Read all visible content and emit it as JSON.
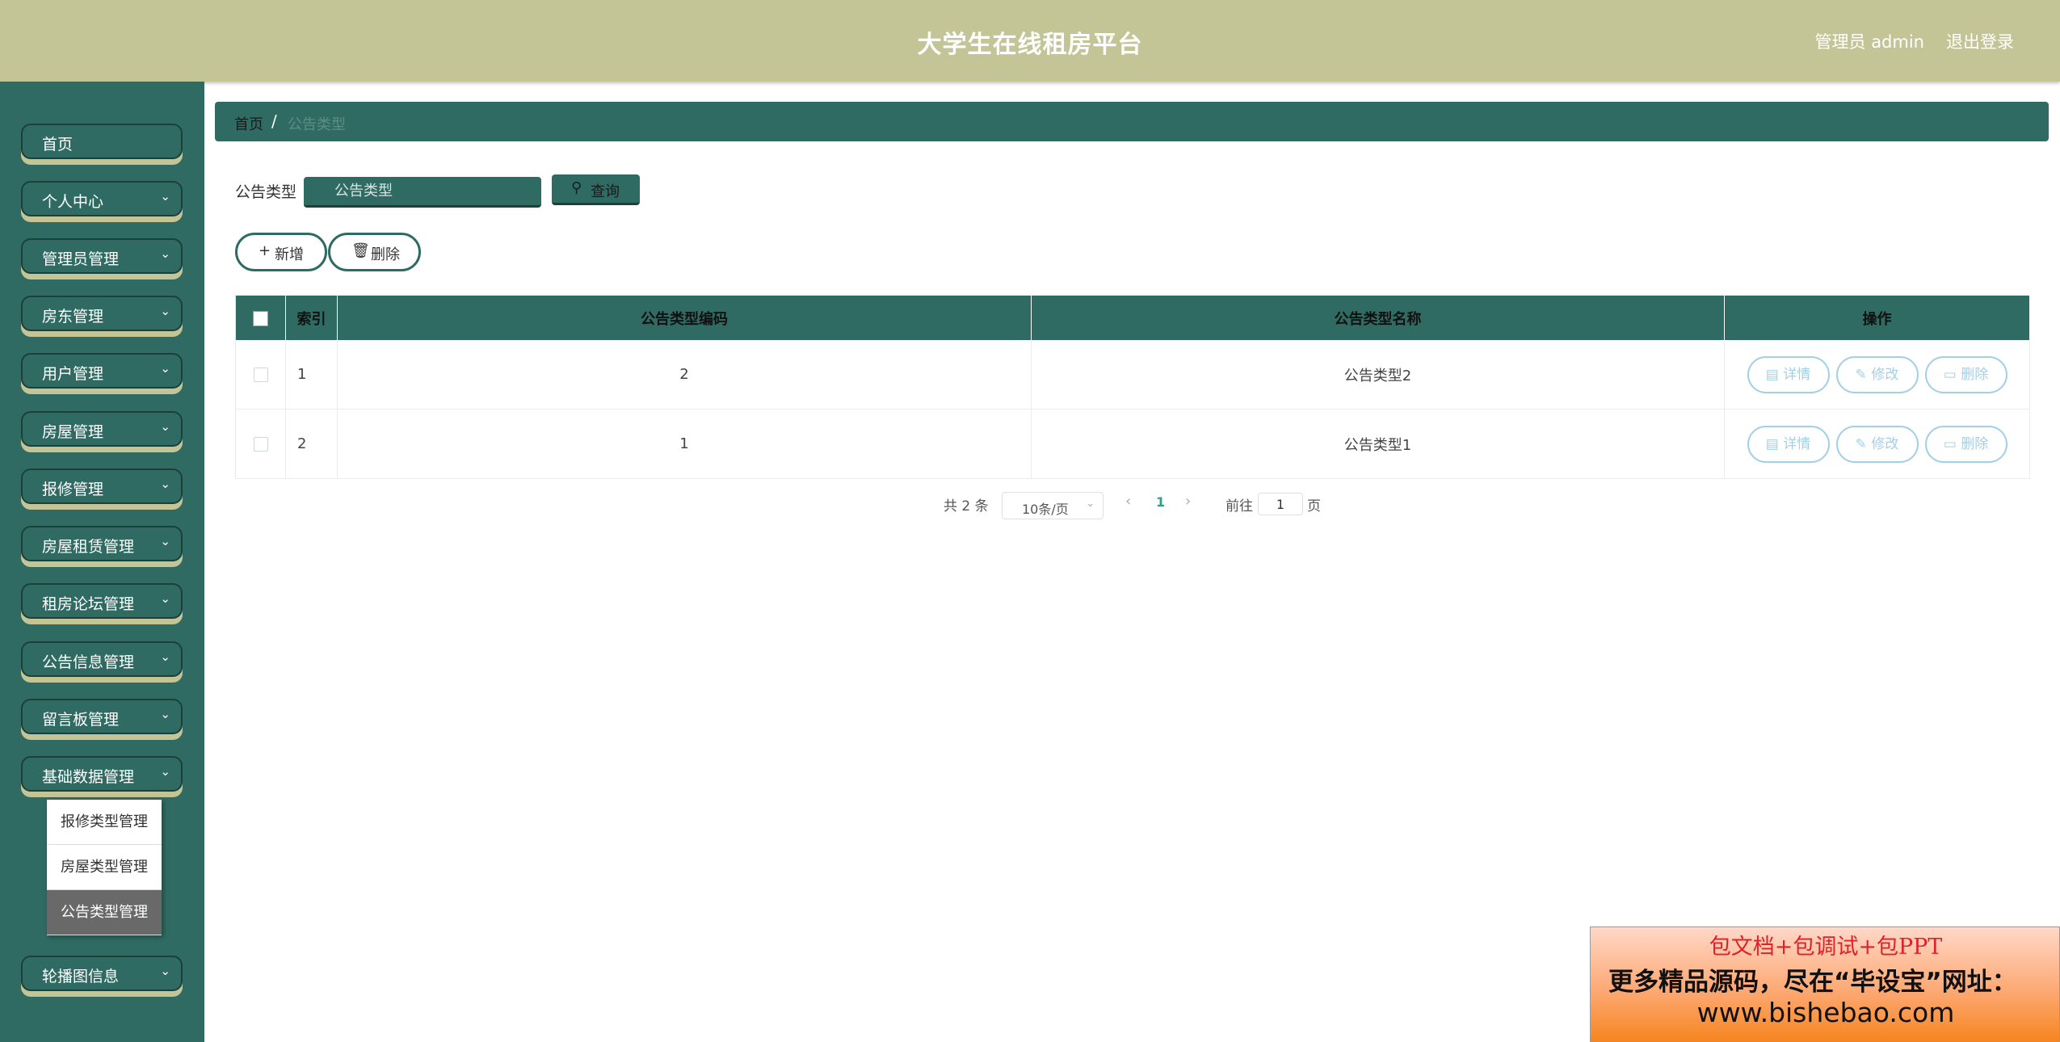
{
  "header": {
    "title": "大学生在线租房平台",
    "admin_label": "管理员 admin",
    "logout": "退出登录"
  },
  "sidebar": {
    "items": [
      {
        "label": "首页",
        "has_chevron": false
      },
      {
        "label": "个人中心",
        "has_chevron": true
      },
      {
        "label": "管理员管理",
        "has_chevron": true
      },
      {
        "label": "房东管理",
        "has_chevron": true
      },
      {
        "label": "用户管理",
        "has_chevron": true
      },
      {
        "label": "房屋管理",
        "has_chevron": true
      },
      {
        "label": "报修管理",
        "has_chevron": true
      },
      {
        "label": "房屋租赁管理",
        "has_chevron": true
      },
      {
        "label": "租房论坛管理",
        "has_chevron": true
      },
      {
        "label": "公告信息管理",
        "has_chevron": true
      },
      {
        "label": "留言板管理",
        "has_chevron": true
      },
      {
        "label": "基础数据管理",
        "has_chevron": true
      },
      {
        "label": "轮播图信息",
        "has_chevron": true
      }
    ],
    "submenu": [
      {
        "label": "报修类型管理",
        "active": false
      },
      {
        "label": "房屋类型管理",
        "active": false
      },
      {
        "label": "公告类型管理",
        "active": true
      }
    ]
  },
  "breadcrumb": {
    "home": "首页",
    "separator": "/",
    "current": "公告类型"
  },
  "search": {
    "label": "公告类型",
    "placeholder": "公告类型",
    "button": "查询",
    "button_icon": "search-icon"
  },
  "actions": {
    "add": "新增",
    "add_icon": "plus-icon",
    "delete": "删除",
    "delete_icon": "trash-icon"
  },
  "table": {
    "columns": [
      "索引",
      "公告类型编码",
      "公告类型名称",
      "操作"
    ],
    "rows": [
      {
        "index": "1",
        "code": "2",
        "name": "公告类型2"
      },
      {
        "index": "2",
        "code": "1",
        "name": "公告类型1"
      }
    ],
    "row_buttons": {
      "detail": "详情",
      "edit": "修改",
      "delete": "删除"
    }
  },
  "pagination": {
    "total": "共 2 条",
    "page_size": "10条/页",
    "current_page": "1",
    "goto_label": "前往",
    "goto_value": "1",
    "page_label": "页"
  },
  "ad": {
    "line1": "包文档+包调试+包PPT",
    "line2": "更多精品源码，尽在“毕设宝”网址：",
    "line3": "www.bishebao.com"
  },
  "colors": {
    "header_bg": "#c3c597",
    "sidebar_bg": "#2f6b62",
    "accent_dark": "#1d3f3a",
    "row_button": "#a3d0e6",
    "active_sub": "#696969"
  }
}
